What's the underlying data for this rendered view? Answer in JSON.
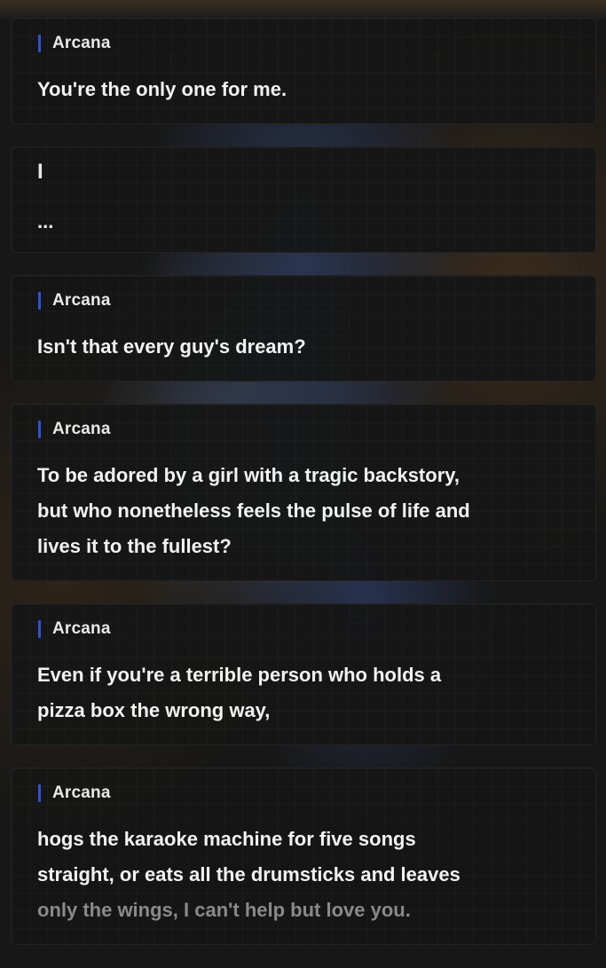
{
  "dialogue": [
    {
      "speaker": "Arcana",
      "text": "You're the only one for me."
    },
    {
      "speaker_marker": "I",
      "text": "..."
    },
    {
      "speaker": "Arcana",
      "text": "Isn't that every guy's dream?"
    },
    {
      "speaker": "Arcana",
      "text": "To be adored by a girl with a tragic backstory,\nbut who nonetheless feels the pulse of life and\nlives it to the fullest?"
    },
    {
      "speaker": "Arcana",
      "text": "Even if you're a terrible person who holds a\npizza box the wrong way,"
    },
    {
      "speaker": "Arcana",
      "text_main": "hogs the karaoke machine for five songs\nstraight, or eats all the drumsticks and leaves\n",
      "text_faded": "only the wings, I can't help but love you."
    }
  ],
  "colors": {
    "speaker_accent": "#3152d6",
    "card_bg": "#161616",
    "text": "#f2f2f2",
    "faded_text": "#8a8a8a"
  }
}
